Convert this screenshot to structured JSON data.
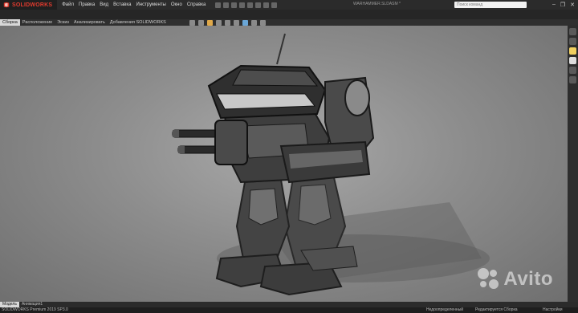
{
  "app": {
    "logo_text": "SOLIDWORKS",
    "logo_prefix": "3S",
    "document_title": "WARHAMMER.SLDASM *"
  },
  "menu": [
    "Файл",
    "Правка",
    "Вид",
    "Вставка",
    "Инструменты",
    "Окно",
    "Справка"
  ],
  "search": {
    "placeholder": "Поиск команд"
  },
  "tabs": [
    "Сборка",
    "Расположение",
    "Эскиз",
    "Анализировать",
    "Добавления SOLIDWORKS"
  ],
  "bottom_tabs": [
    "Модель",
    "Анимация1"
  ],
  "status": {
    "version": "SOLIDWORKS Premium 2019 SP3.0",
    "definition": "Недоопределенный",
    "mode": "Редактируется Сборка",
    "settings": "Настройки"
  },
  "watermark": {
    "text": "Avito"
  },
  "icons": {
    "task_pane": [
      "home-icon",
      "parts-icon",
      "folder-icon",
      "appearance-icon",
      "palette-icon",
      "custom-properties-icon"
    ]
  },
  "colors": {
    "accent": "#e23b2e",
    "viewport_light": "#a9a9a9",
    "viewport_dark": "#6f6f6f"
  }
}
